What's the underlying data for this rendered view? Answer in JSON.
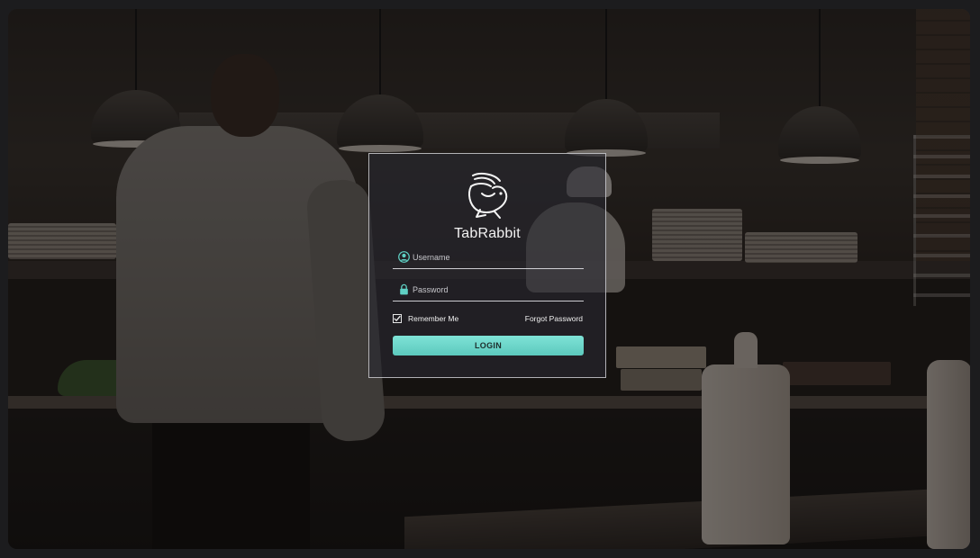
{
  "app": {
    "brand_name": "TabRabbit",
    "logo_icon": "rabbit-logo-icon"
  },
  "login_form": {
    "username": {
      "placeholder": "Username",
      "value": "",
      "icon": "user-icon"
    },
    "password": {
      "placeholder": "Password",
      "value": "",
      "icon": "lock-icon"
    },
    "remember_me": {
      "label": "Remember Me",
      "checked": true
    },
    "forgot_password_label": "Forgot Password",
    "submit_label": "LOGIN"
  },
  "colors": {
    "accent": "#66d3c6",
    "icon_accent": "#5fd0c4",
    "text": "#f2f2f2",
    "card_border": "#e1e1e6"
  }
}
